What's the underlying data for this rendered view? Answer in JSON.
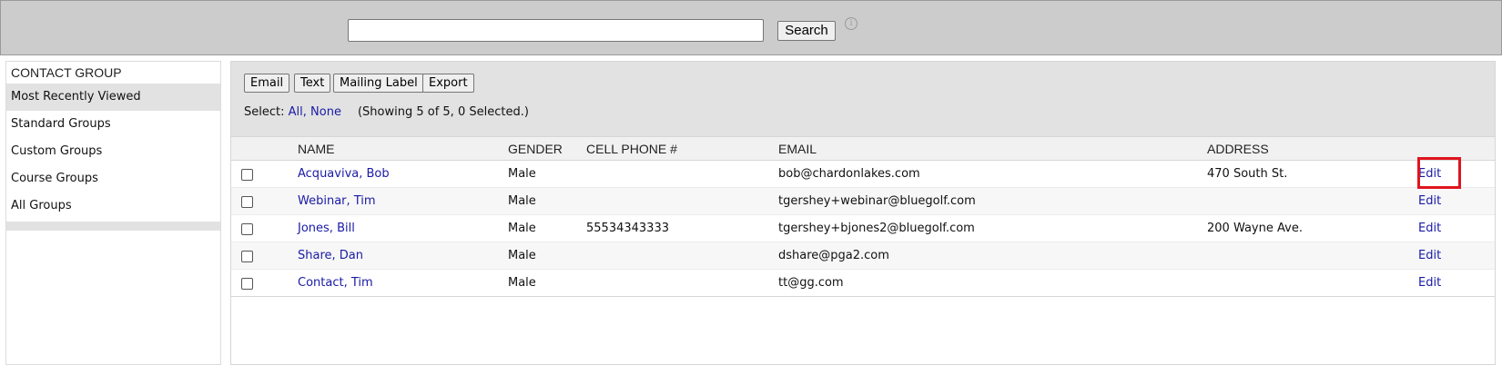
{
  "search": {
    "placeholder": "",
    "button_label": "Search",
    "info_icon": "info-icon"
  },
  "sidebar": {
    "header": "CONTACT GROUP",
    "items": [
      {
        "label": "Most Recently Viewed",
        "active": true
      },
      {
        "label": "Standard Groups"
      },
      {
        "label": "Custom Groups"
      },
      {
        "label": "Course Groups"
      },
      {
        "label": "All Groups"
      }
    ]
  },
  "toolbar": {
    "buttons": [
      "Email",
      "Text",
      "Mailing Label",
      "Export"
    ],
    "select_label": "Select:",
    "select_all": "All",
    "select_separator": ",",
    "select_none": "None",
    "showing": "(Showing 5 of 5, 0 Selected.)"
  },
  "table": {
    "columns": [
      "NAME",
      "GENDER",
      "CELL PHONE #",
      "EMAIL",
      "ADDRESS"
    ],
    "rows": [
      {
        "name": "Acquaviva, Bob",
        "gender": "Male",
        "phone": "",
        "email": "bob@chardonlakes.com",
        "address": "470 South St.",
        "edit": "Edit"
      },
      {
        "name": "Webinar, Tim",
        "gender": "Male",
        "phone": "",
        "email": "tgershey+webinar@bluegolf.com",
        "address": "",
        "edit": "Edit"
      },
      {
        "name": "Jones, Bill",
        "gender": "Male",
        "phone": "55534343333",
        "email": "tgershey+bjones2@bluegolf.com",
        "address": "200 Wayne Ave.",
        "edit": "Edit"
      },
      {
        "name": "Share, Dan",
        "gender": "Male",
        "phone": "",
        "email": "dshare@pga2.com",
        "address": "",
        "edit": "Edit"
      },
      {
        "name": "Contact, Tim",
        "gender": "Male",
        "phone": "",
        "email": "tt@gg.com",
        "address": "",
        "edit": "Edit"
      }
    ]
  },
  "colors": {
    "link": "#1a1aa6",
    "topbar": "#cccccc",
    "toolbar": "#e2e2e2",
    "highlight": "#e0141e"
  }
}
